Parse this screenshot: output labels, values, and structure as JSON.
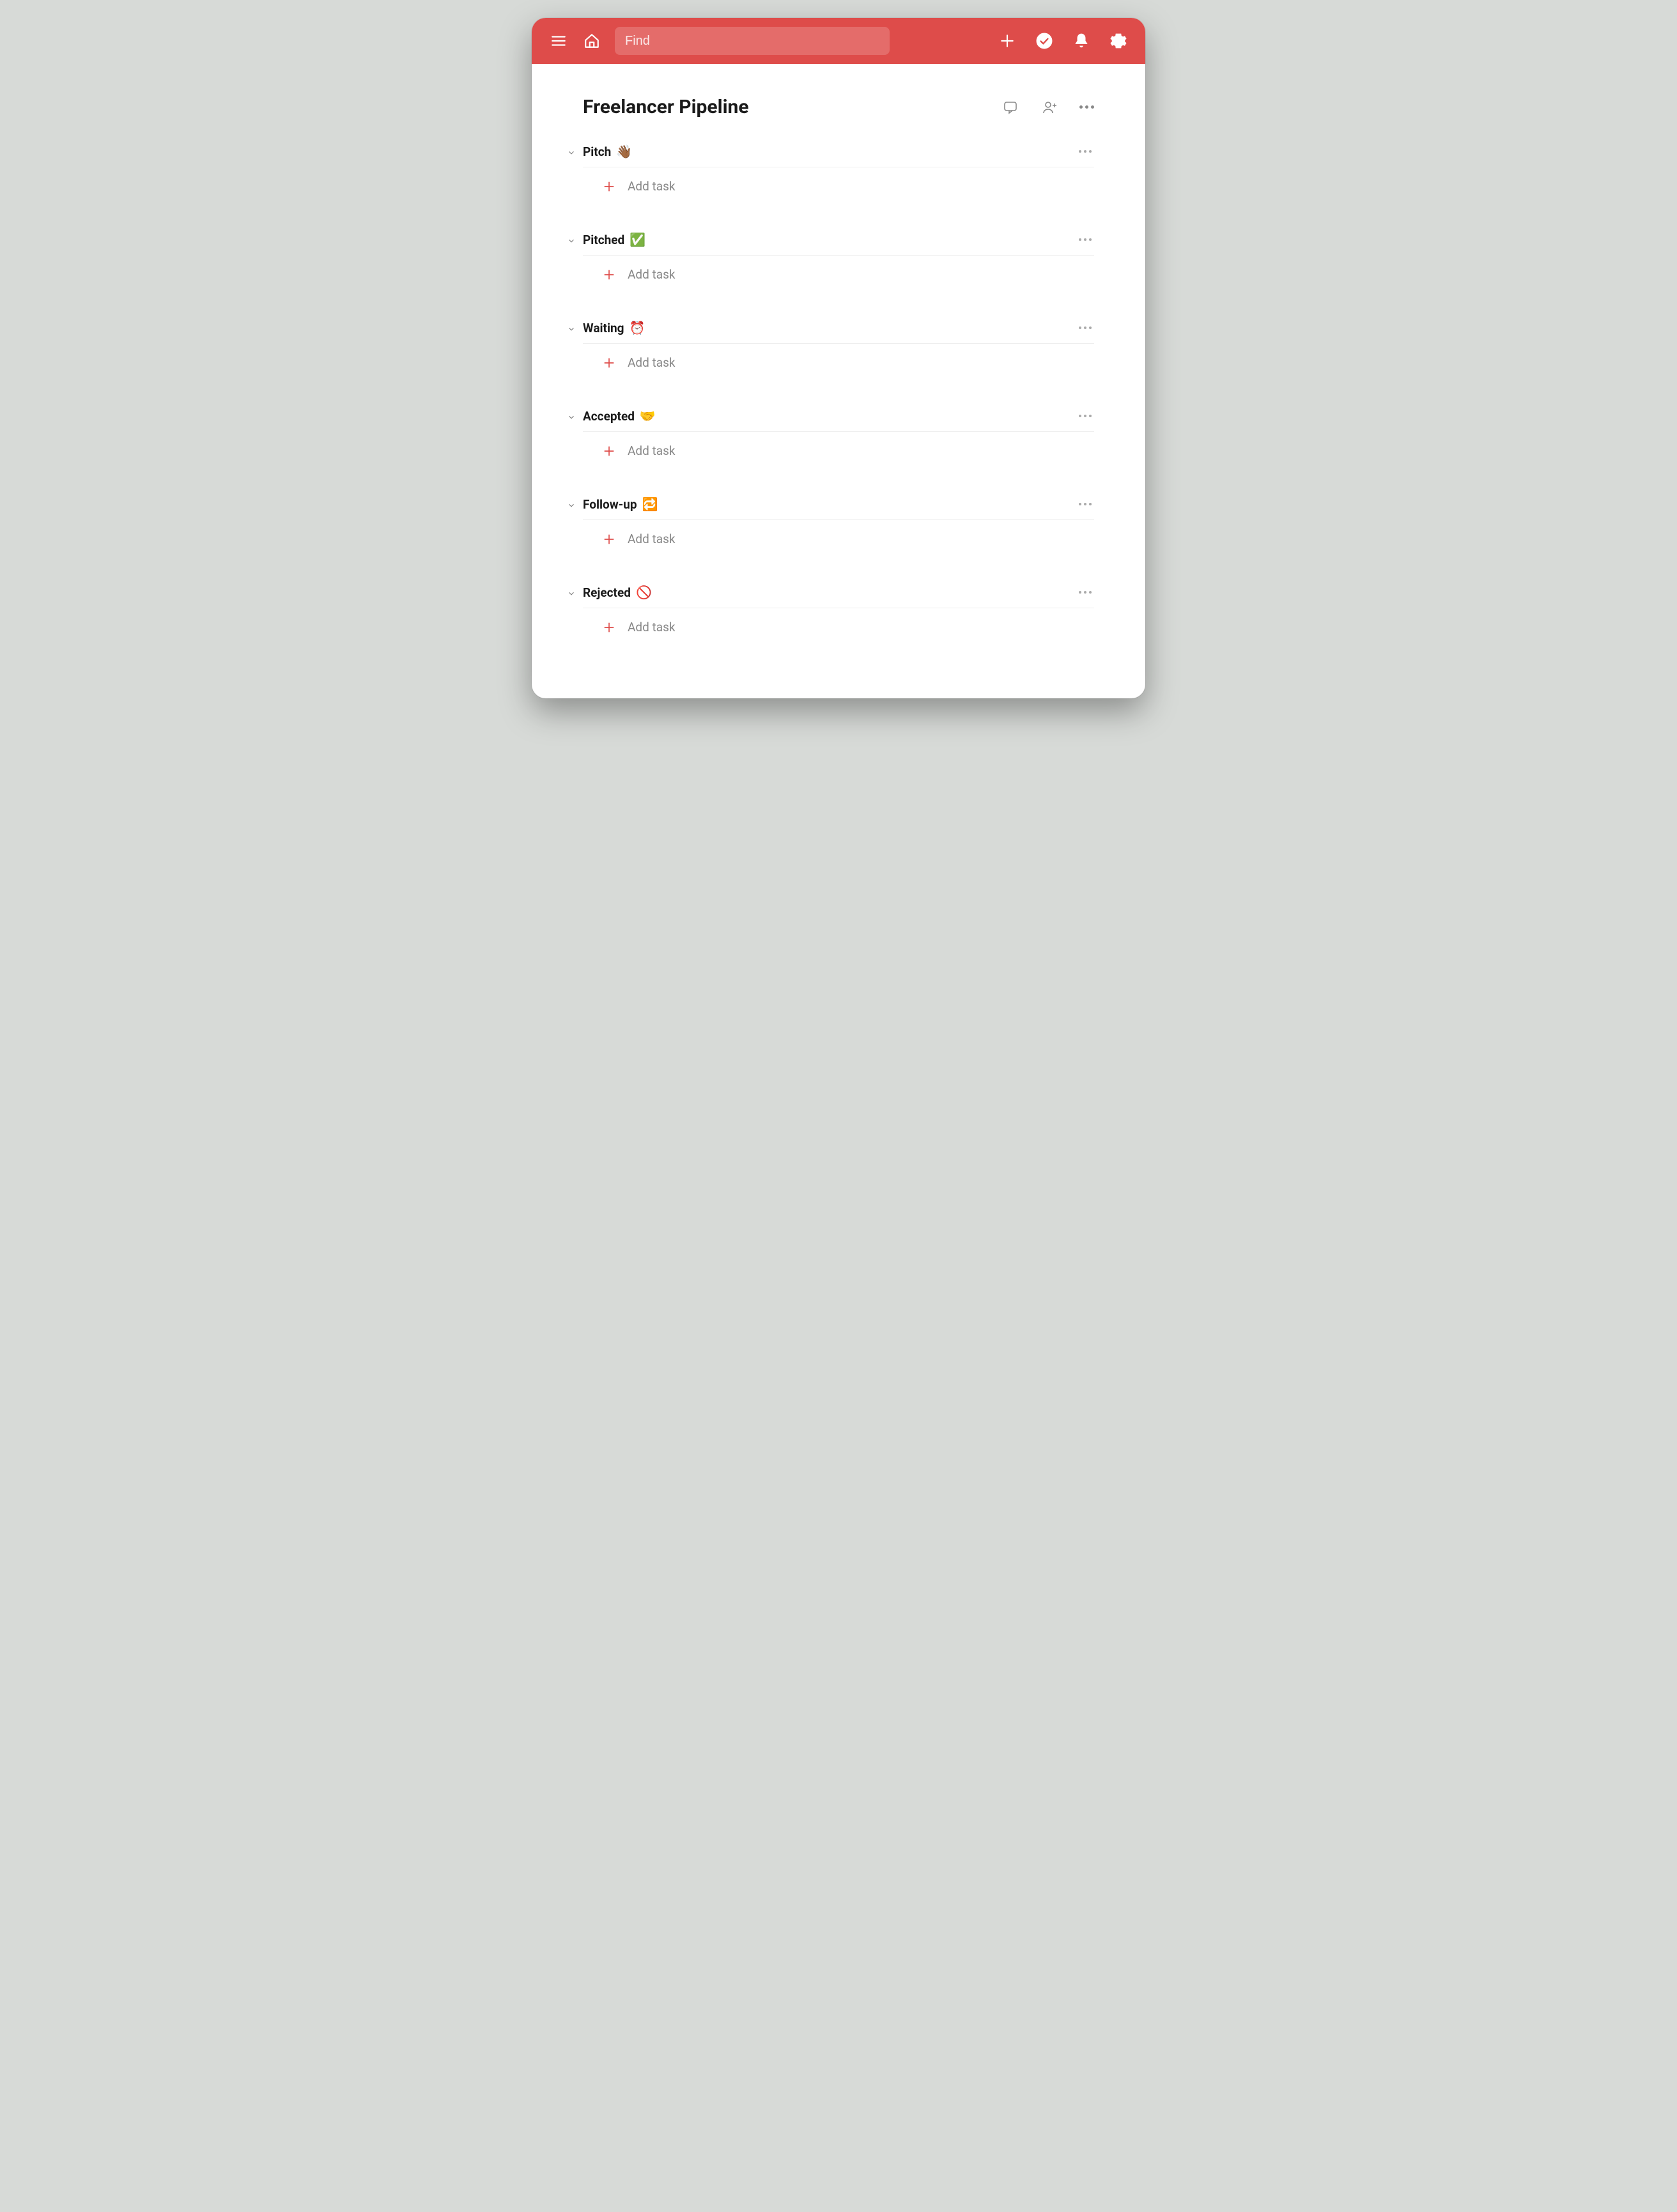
{
  "topbar": {
    "search_placeholder": "Find"
  },
  "project": {
    "title": "Freelancer Pipeline"
  },
  "add_task_label": "Add task",
  "sections": [
    {
      "name": "Pitch",
      "emoji": "👋🏾"
    },
    {
      "name": "Pitched",
      "emoji": "✅"
    },
    {
      "name": "Waiting",
      "emoji": "⏰"
    },
    {
      "name": "Accepted",
      "emoji": "🤝"
    },
    {
      "name": "Follow-up",
      "emoji": "🔁"
    },
    {
      "name": "Rejected",
      "emoji": "🚫"
    }
  ]
}
